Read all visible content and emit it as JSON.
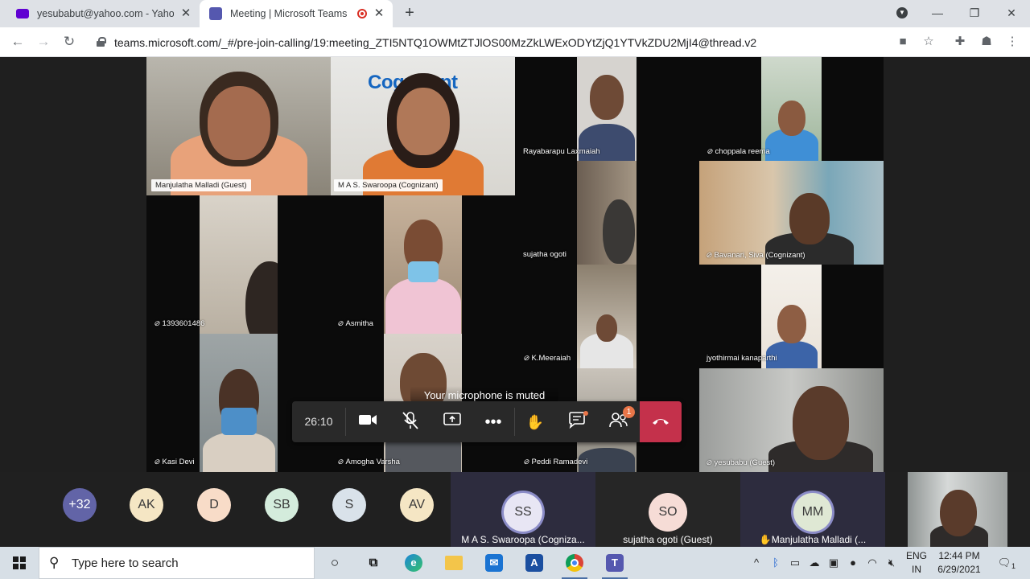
{
  "browser": {
    "tabs": [
      {
        "title": "yesubabut@yahoo.com - Yahoo Mail",
        "icon": "yahoo-mail-icon"
      },
      {
        "title": "Meeting | Microsoft Teams",
        "icon": "teams-icon",
        "recording": true
      }
    ],
    "new_tab": "+",
    "url": "teams.microsoft.com/_#/pre-join-calling/19:meeting_ZTI5NTQ1OWMtZTJlOS00MzZkLWExODYtZjQ1YTVkZDU2MjI4@thread.v2",
    "window_controls": {
      "minimize": "—",
      "restore": "❐",
      "close": "✕"
    }
  },
  "meeting": {
    "timer": "26:10",
    "toast": "Your microphone is muted",
    "participants_badge": "1",
    "sign_text": "Cognizant",
    "tiles": {
      "manjulatha": "Manjulatha Malladi (Guest)",
      "swaroopa": "M A S. Swaroopa (Cognizant)",
      "laxmaiah": "Rayabarapu Laxmaiah",
      "reema": "choppala reema",
      "sujatha": "sujatha ogoti",
      "bavanari": "Bavanari, Siva (Cognizant)",
      "num": "1393601486",
      "asmitha": "Asmitha",
      "meeraiah": "K.Meeraiah",
      "jyothirmai": "jyothirmai kanaparthi",
      "kasi": "Kasi Devi",
      "amogha": "Amogha Varsha",
      "peddi": "Peddi Ramadevi",
      "yesubabu": "yesubabu (Guest)"
    }
  },
  "participant_row": {
    "avatars": [
      {
        "initials": "+32",
        "color": "#6264a7"
      },
      {
        "initials": "AK",
        "color": "#f5e6c4"
      },
      {
        "initials": "D",
        "color": "#f8dcc8"
      },
      {
        "initials": "SB",
        "color": "#d4ecdc"
      },
      {
        "initials": "S",
        "color": "#d9e2ea"
      },
      {
        "initials": "AV",
        "color": "#f5e6c4"
      }
    ],
    "tiles": [
      {
        "initials": "SS",
        "name": "M A S. Swaroopa (Cogniza...",
        "color": "#e8e6f4"
      },
      {
        "initials": "SO",
        "name": "sujatha ogoti (Guest)",
        "color": "#f6dcd6"
      },
      {
        "initials": "MM",
        "name": "Manjulatha Malladi (...",
        "color": "#dfe8d4"
      }
    ]
  },
  "taskbar": {
    "search_placeholder": "Type here to search",
    "lang_top": "ENG",
    "lang_bottom": "IN",
    "time": "12:44 PM",
    "date": "6/29/2021",
    "notification_count": "1"
  }
}
